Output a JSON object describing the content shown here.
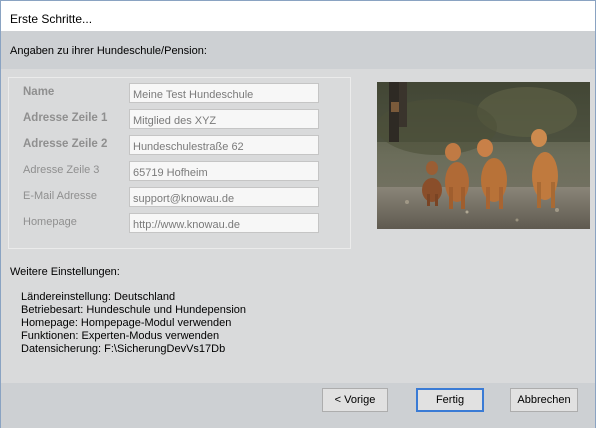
{
  "window": {
    "title": "Erste Schritte..."
  },
  "header": {
    "text": "Angaben zu ihrer Hundeschule/Pension:"
  },
  "form": {
    "fields": [
      {
        "label": "Name",
        "value": "Meine Test Hundeschule"
      },
      {
        "label": "Adresse Zeile 1",
        "value": "Mitglied des XYZ"
      },
      {
        "label": "Adresse Zeile 2",
        "value": "Hundeschulestraße 62"
      },
      {
        "label": "Adresse Zeile 3",
        "value": "65719 Hofheim"
      },
      {
        "label": "E-Mail Adresse",
        "value": "support@knowau.de"
      },
      {
        "label": "Homepage",
        "value": "http://www.knowau.de"
      }
    ]
  },
  "settings": {
    "title": "Weitere Einstellungen:",
    "items": [
      "Ländereinstellung: Deutschland",
      "Betriebesart: Hundeschule und Hundepension",
      "Homepage: Hompepage-Modul verwenden",
      "Funktionen: Experten-Modus verwenden",
      "Datensicherung: F:\\SicherungDevVs17Db"
    ]
  },
  "buttons": {
    "back": "< Vorige",
    "finish": "Fertig",
    "cancel": "Abbrechen"
  },
  "colors": {
    "accent": "#3a7bd5",
    "panel": "#d9dadb",
    "chrome": "#cdd0d3"
  }
}
